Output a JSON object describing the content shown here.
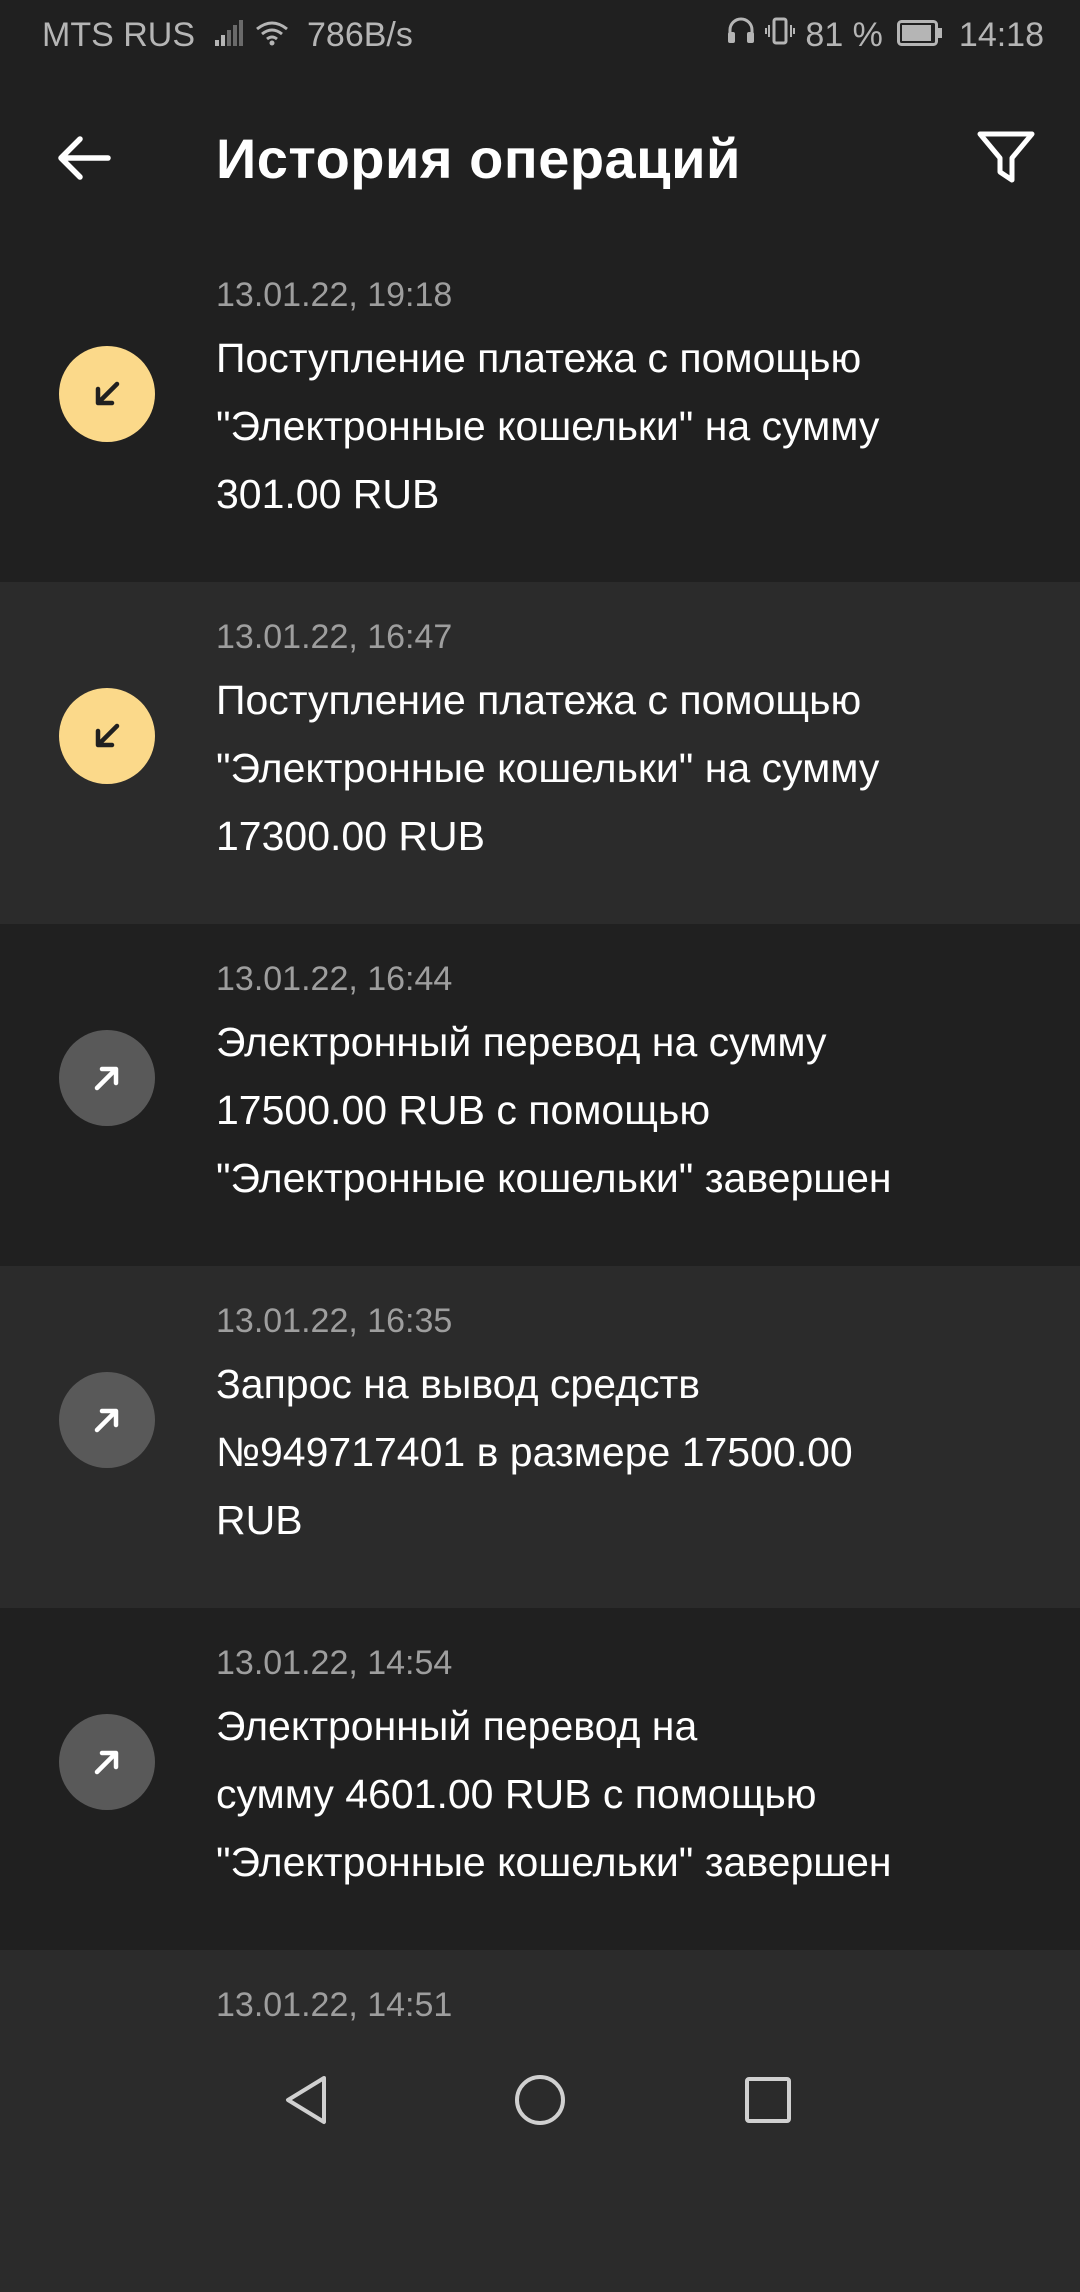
{
  "status_bar": {
    "carrier": "MTS RUS",
    "net_speed": "786B/s",
    "battery_pct": "81 %",
    "time": "14:18",
    "icons": [
      "signal-icon",
      "wifi-icon",
      "headphones-icon",
      "vibrate-icon",
      "battery-icon"
    ]
  },
  "app_bar": {
    "title": "История операций",
    "back_icon": "arrow-left-icon",
    "filter_icon": "filter-icon"
  },
  "colors": {
    "background": "#202020",
    "row_alt": "#2b2b2b",
    "incoming_icon_bg": "#fbd98a",
    "outgoing_icon_bg": "#595959",
    "timestamp": "#9e9e9e"
  },
  "operations": [
    {
      "timestamp": "13.01.22, 19:18",
      "direction": "incoming",
      "icon": "arrow-down-left-icon",
      "lines": [
        "Поступление платежа с помощью",
        "\"Электронные кошельки\" на сумму",
        "301.00 RUB"
      ]
    },
    {
      "timestamp": "13.01.22, 16:47",
      "direction": "incoming",
      "icon": "arrow-down-left-icon",
      "lines": [
        "Поступление платежа с помощью",
        "\"Электронные кошельки\" на сумму",
        "17300.00 RUB"
      ]
    },
    {
      "timestamp": "13.01.22, 16:44",
      "direction": "outgoing",
      "icon": "arrow-up-right-icon",
      "lines": [
        "Электронный перевод на сумму",
        "17500.00 RUB с помощью",
        "\"Электронные кошельки\" завершен"
      ]
    },
    {
      "timestamp": "13.01.22, 16:35",
      "direction": "outgoing",
      "icon": "arrow-up-right-icon",
      "lines": [
        "Запрос на вывод средств",
        "№949717401 в размере 17500.00",
        "RUB"
      ]
    },
    {
      "timestamp": "13.01.22, 14:54",
      "direction": "outgoing",
      "icon": "arrow-up-right-icon",
      "lines": [
        "Электронный перевод на",
        "сумму 4601.00 RUB с помощью",
        "\"Электронные кошельки\" завершен"
      ]
    },
    {
      "timestamp": "13.01.22, 14:51",
      "direction": "",
      "icon": "",
      "lines": []
    }
  ],
  "nav_bar": {
    "back_icon": "nav-back-icon",
    "home_icon": "nav-home-icon",
    "recents_icon": "nav-recents-icon"
  }
}
